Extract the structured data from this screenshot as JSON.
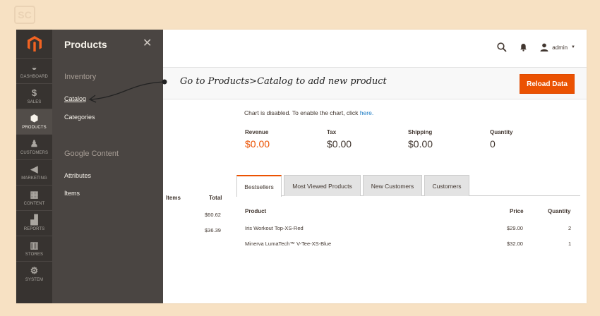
{
  "nav": {
    "items": [
      {
        "label": "DASHBOARD",
        "icon": "dashboard-icon"
      },
      {
        "label": "SALES",
        "icon": "dollar-icon"
      },
      {
        "label": "PRODUCTS",
        "icon": "cube-icon"
      },
      {
        "label": "CUSTOMERS",
        "icon": "person-icon"
      },
      {
        "label": "MARKETING",
        "icon": "megaphone-icon"
      },
      {
        "label": "CONTENT",
        "icon": "layout-icon"
      },
      {
        "label": "REPORTS",
        "icon": "bar-chart-icon"
      },
      {
        "label": "STORES",
        "icon": "store-icon"
      },
      {
        "label": "SYSTEM",
        "icon": "gear-icon"
      }
    ]
  },
  "flyout": {
    "title": "Products",
    "close": "✕",
    "sections": [
      {
        "title": "Inventory",
        "links": [
          "Catalog",
          "Categories"
        ]
      },
      {
        "title": "Google Content",
        "links": [
          "Attributes",
          "Items"
        ]
      }
    ]
  },
  "header": {
    "user": "admin",
    "accent": "#eb5202"
  },
  "actionbar": {
    "reload_label": "Reload Data"
  },
  "annotation": "Go to Products>Catalog to add new product",
  "chart": {
    "message": "Chart is disabled. To enable the chart, click",
    "link": "here."
  },
  "metrics": [
    {
      "label": "Revenue",
      "value": "$0.00"
    },
    {
      "label": "Tax",
      "value": "$0.00"
    },
    {
      "label": "Shipping",
      "value": "$0.00"
    },
    {
      "label": "Quantity",
      "value": "0"
    }
  ],
  "left_table": {
    "headers": [
      "Items",
      "Total"
    ],
    "rows": [
      [
        "$60.62"
      ],
      [
        "$36.39"
      ]
    ]
  },
  "tabs": [
    "Bestsellers",
    "Most Viewed Products",
    "New Customers",
    "Customers"
  ],
  "bestsellers": {
    "headers": [
      "Product",
      "Price",
      "Quantity"
    ],
    "rows": [
      {
        "product": "Iris Workout Top-XS-Red",
        "price": "$29.00",
        "qty": "2"
      },
      {
        "product": "Minerva LumaTech™ V-Tee-XS-Blue",
        "price": "$32.00",
        "qty": "1"
      }
    ]
  }
}
